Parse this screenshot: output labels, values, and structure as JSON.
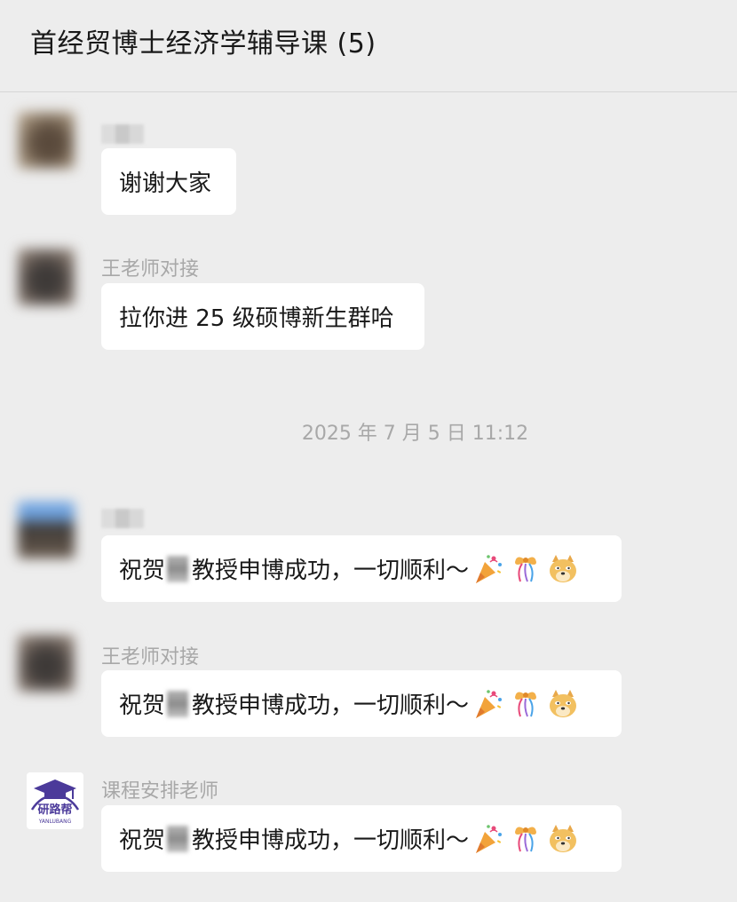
{
  "header": {
    "title": "首经贸博士经济学辅导课 (5)"
  },
  "messages": [
    {
      "sender": "",
      "text": "谢谢大家"
    },
    {
      "sender": "王老师对接",
      "text": "拉你进 25 级硕博新生群哈"
    },
    {
      "sender": "",
      "text_before": "祝贺",
      "text_after": "教授申博成功，一切顺利～"
    },
    {
      "sender": "王老师对接",
      "text_before": "祝贺",
      "text_after": "教授申博成功，一切顺利～"
    },
    {
      "sender": "课程安排老师",
      "text_before": "祝贺",
      "text_after": "教授申博成功，一切顺利～"
    }
  ],
  "timestamp": "2025 年 7 月 5 日 11:12",
  "logo": {
    "main": "研路帮",
    "sub": "YANLUBANG"
  },
  "icons": [
    "party-popper-icon",
    "ribbon-icon",
    "doge-icon"
  ]
}
